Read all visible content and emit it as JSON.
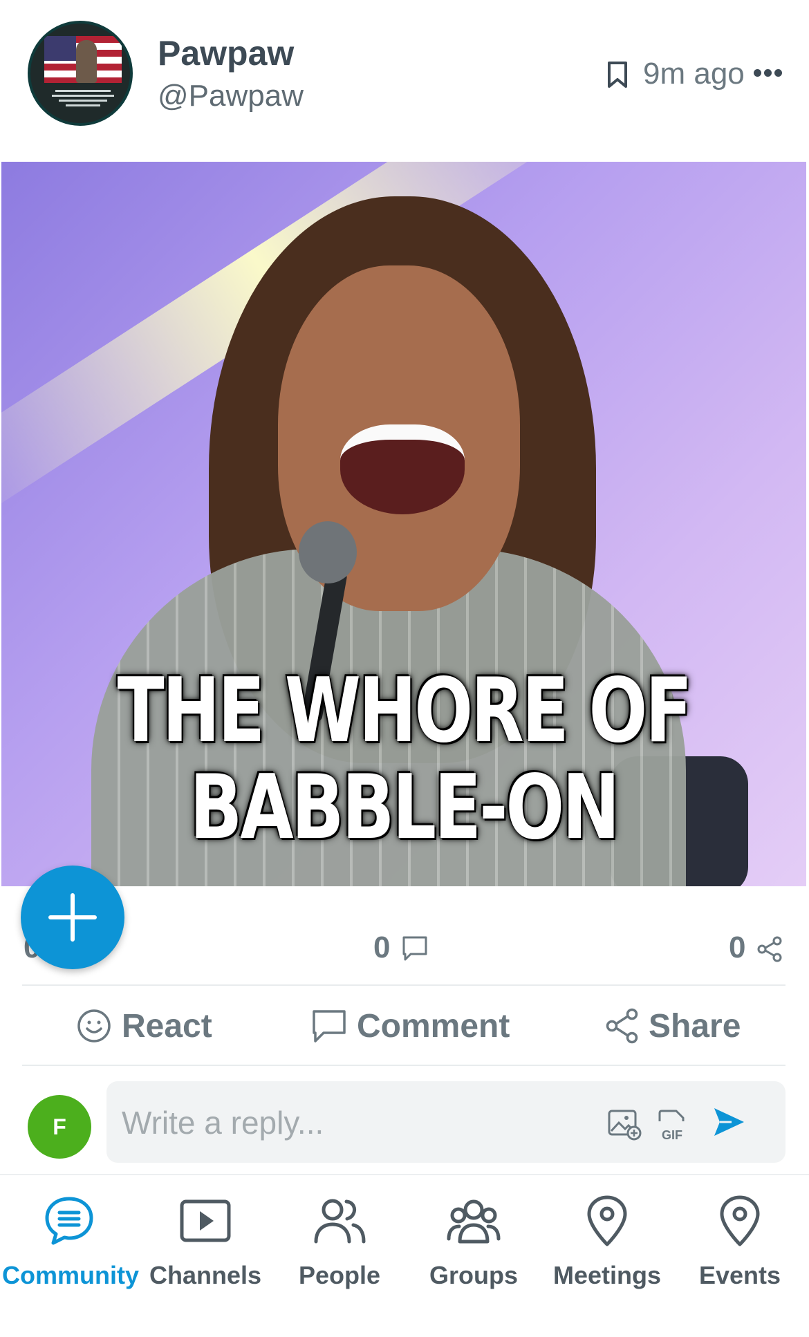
{
  "post": {
    "author_name": "Pawpaw",
    "author_handle": "@Pawpaw",
    "timestamp": "9m ago",
    "image_caption_line1": "THE WHORE OF",
    "image_caption_line2": "BABBLE-ON",
    "reaction_count": "0",
    "comment_count": "0",
    "share_count": "0"
  },
  "actions": {
    "react_label": "React",
    "comment_label": "Comment",
    "share_label": "Share"
  },
  "reply": {
    "avatar_initial": "F",
    "placeholder": "Write a reply...",
    "gif_label": "GIF"
  },
  "bottom_nav": {
    "items": [
      {
        "label": "Community",
        "icon": "chat-icon",
        "active": true
      },
      {
        "label": "Channels",
        "icon": "play-icon",
        "active": false
      },
      {
        "label": "People",
        "icon": "people-icon",
        "active": false
      },
      {
        "label": "Groups",
        "icon": "groups-icon",
        "active": false
      },
      {
        "label": "Meetings",
        "icon": "map-pin-icon",
        "active": false
      },
      {
        "label": "Events",
        "icon": "map-pin-icon",
        "active": false
      }
    ]
  },
  "colors": {
    "accent": "#0d94d6",
    "avatar_green": "#4caf1d",
    "text_gray": "#6b7880"
  }
}
